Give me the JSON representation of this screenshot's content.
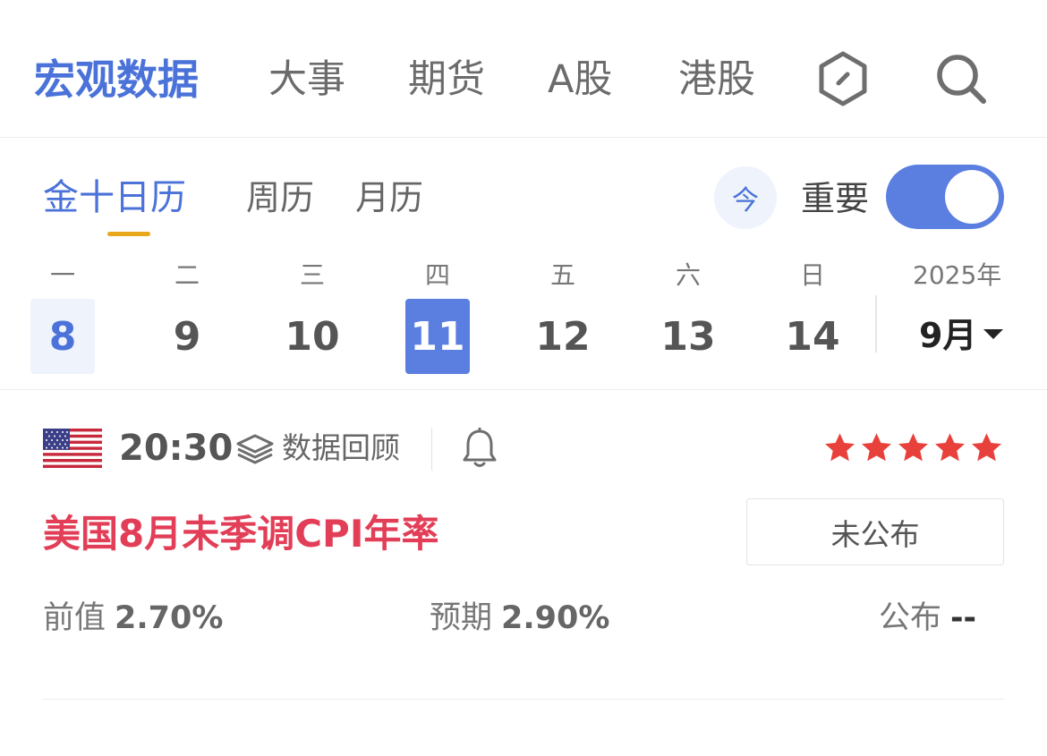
{
  "top_nav": {
    "tabs": [
      {
        "label": "宏观数据",
        "active": true
      },
      {
        "label": "大事"
      },
      {
        "label": "期货"
      },
      {
        "label": "A股"
      },
      {
        "label": "港股"
      }
    ],
    "icons": [
      "hexagon-app-icon",
      "search-icon"
    ]
  },
  "calendar_tabs": [
    {
      "label": "金十日历",
      "active": true
    },
    {
      "label": "周历"
    },
    {
      "label": "月历"
    }
  ],
  "today_button": "今",
  "important_toggle": {
    "label": "重要",
    "on": true
  },
  "week": {
    "weekdays": [
      "一",
      "二",
      "三",
      "四",
      "五",
      "六",
      "日"
    ],
    "days": [
      "8",
      "9",
      "10",
      "11",
      "12",
      "13",
      "14"
    ],
    "today_index": 0,
    "selected_index": 3,
    "year": "2025年",
    "month": "9月"
  },
  "event": {
    "country_flag": "us-flag",
    "time": "20:30",
    "review_label": "数据回顾",
    "stars": 5,
    "star_color": "#e8413c",
    "title": "美国8月未季调CPI年率",
    "status": "未公布",
    "previous": {
      "label": "前值",
      "value": "2.70%"
    },
    "expected": {
      "label": "预期",
      "value": "2.90%"
    },
    "actual": {
      "label": "公布",
      "value": "--"
    }
  },
  "colors": {
    "accent": "#4a72d9",
    "toggle": "#5b7fe0",
    "title_red": "#e23e57",
    "underline": "#e8a81c"
  }
}
